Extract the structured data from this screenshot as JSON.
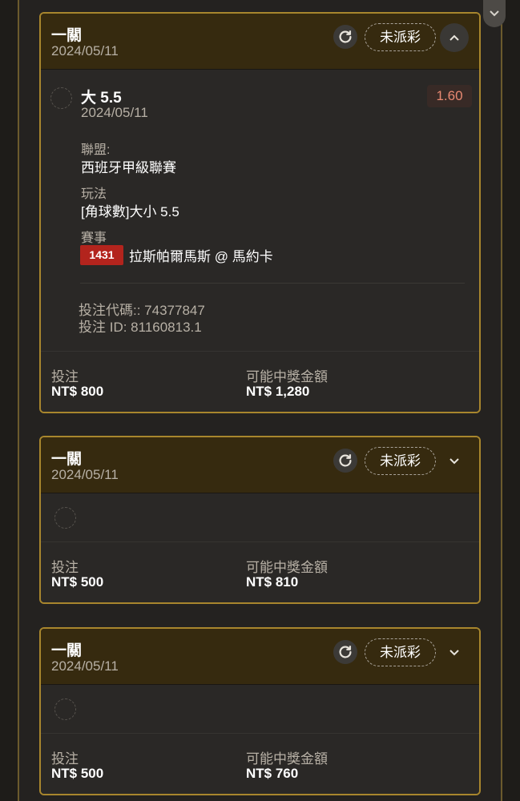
{
  "cards": [
    {
      "title": "一關",
      "date": "2024/05/11",
      "status": "未派彩",
      "expanded": true,
      "selection": {
        "title": "大 5.5",
        "date": "2024/05/11",
        "odds": "1.60",
        "league_label": "聯盟:",
        "league": "西班牙甲級聯賽",
        "bet_type_label": "玩法",
        "bet_type": "[角球數]大小 5.5",
        "event_label": "賽事",
        "event_id": "1431",
        "event": "拉斯帕爾馬斯 @ 馬約卡"
      },
      "bet_code": "投注代碼:: 74377847",
      "bet_id": "投注 ID: 81160813.1",
      "stake_label": "投注",
      "stake": "NT$ 800",
      "payout_label": "可能中獎金額",
      "payout": "NT$ 1,280"
    },
    {
      "title": "一關",
      "date": "2024/05/11",
      "status": "未派彩",
      "expanded": false,
      "stake_label": "投注",
      "stake": "NT$ 500",
      "payout_label": "可能中獎金額",
      "payout": "NT$ 810"
    },
    {
      "title": "一關",
      "date": "2024/05/11",
      "status": "未派彩",
      "expanded": false,
      "stake_label": "投注",
      "stake": "NT$ 500",
      "payout_label": "可能中獎金額",
      "payout": "NT$ 760"
    }
  ],
  "icons": {
    "refresh": "refresh-icon",
    "chevron_up": "chevron-up-icon",
    "chevron_down": "chevron-down-icon",
    "scroll": "scroll-down-icon"
  },
  "colors": {
    "accent_border": "#a8862d",
    "header_bg": "#362a0f",
    "odds_color": "#e88972",
    "tag_red": "#b3241d"
  }
}
